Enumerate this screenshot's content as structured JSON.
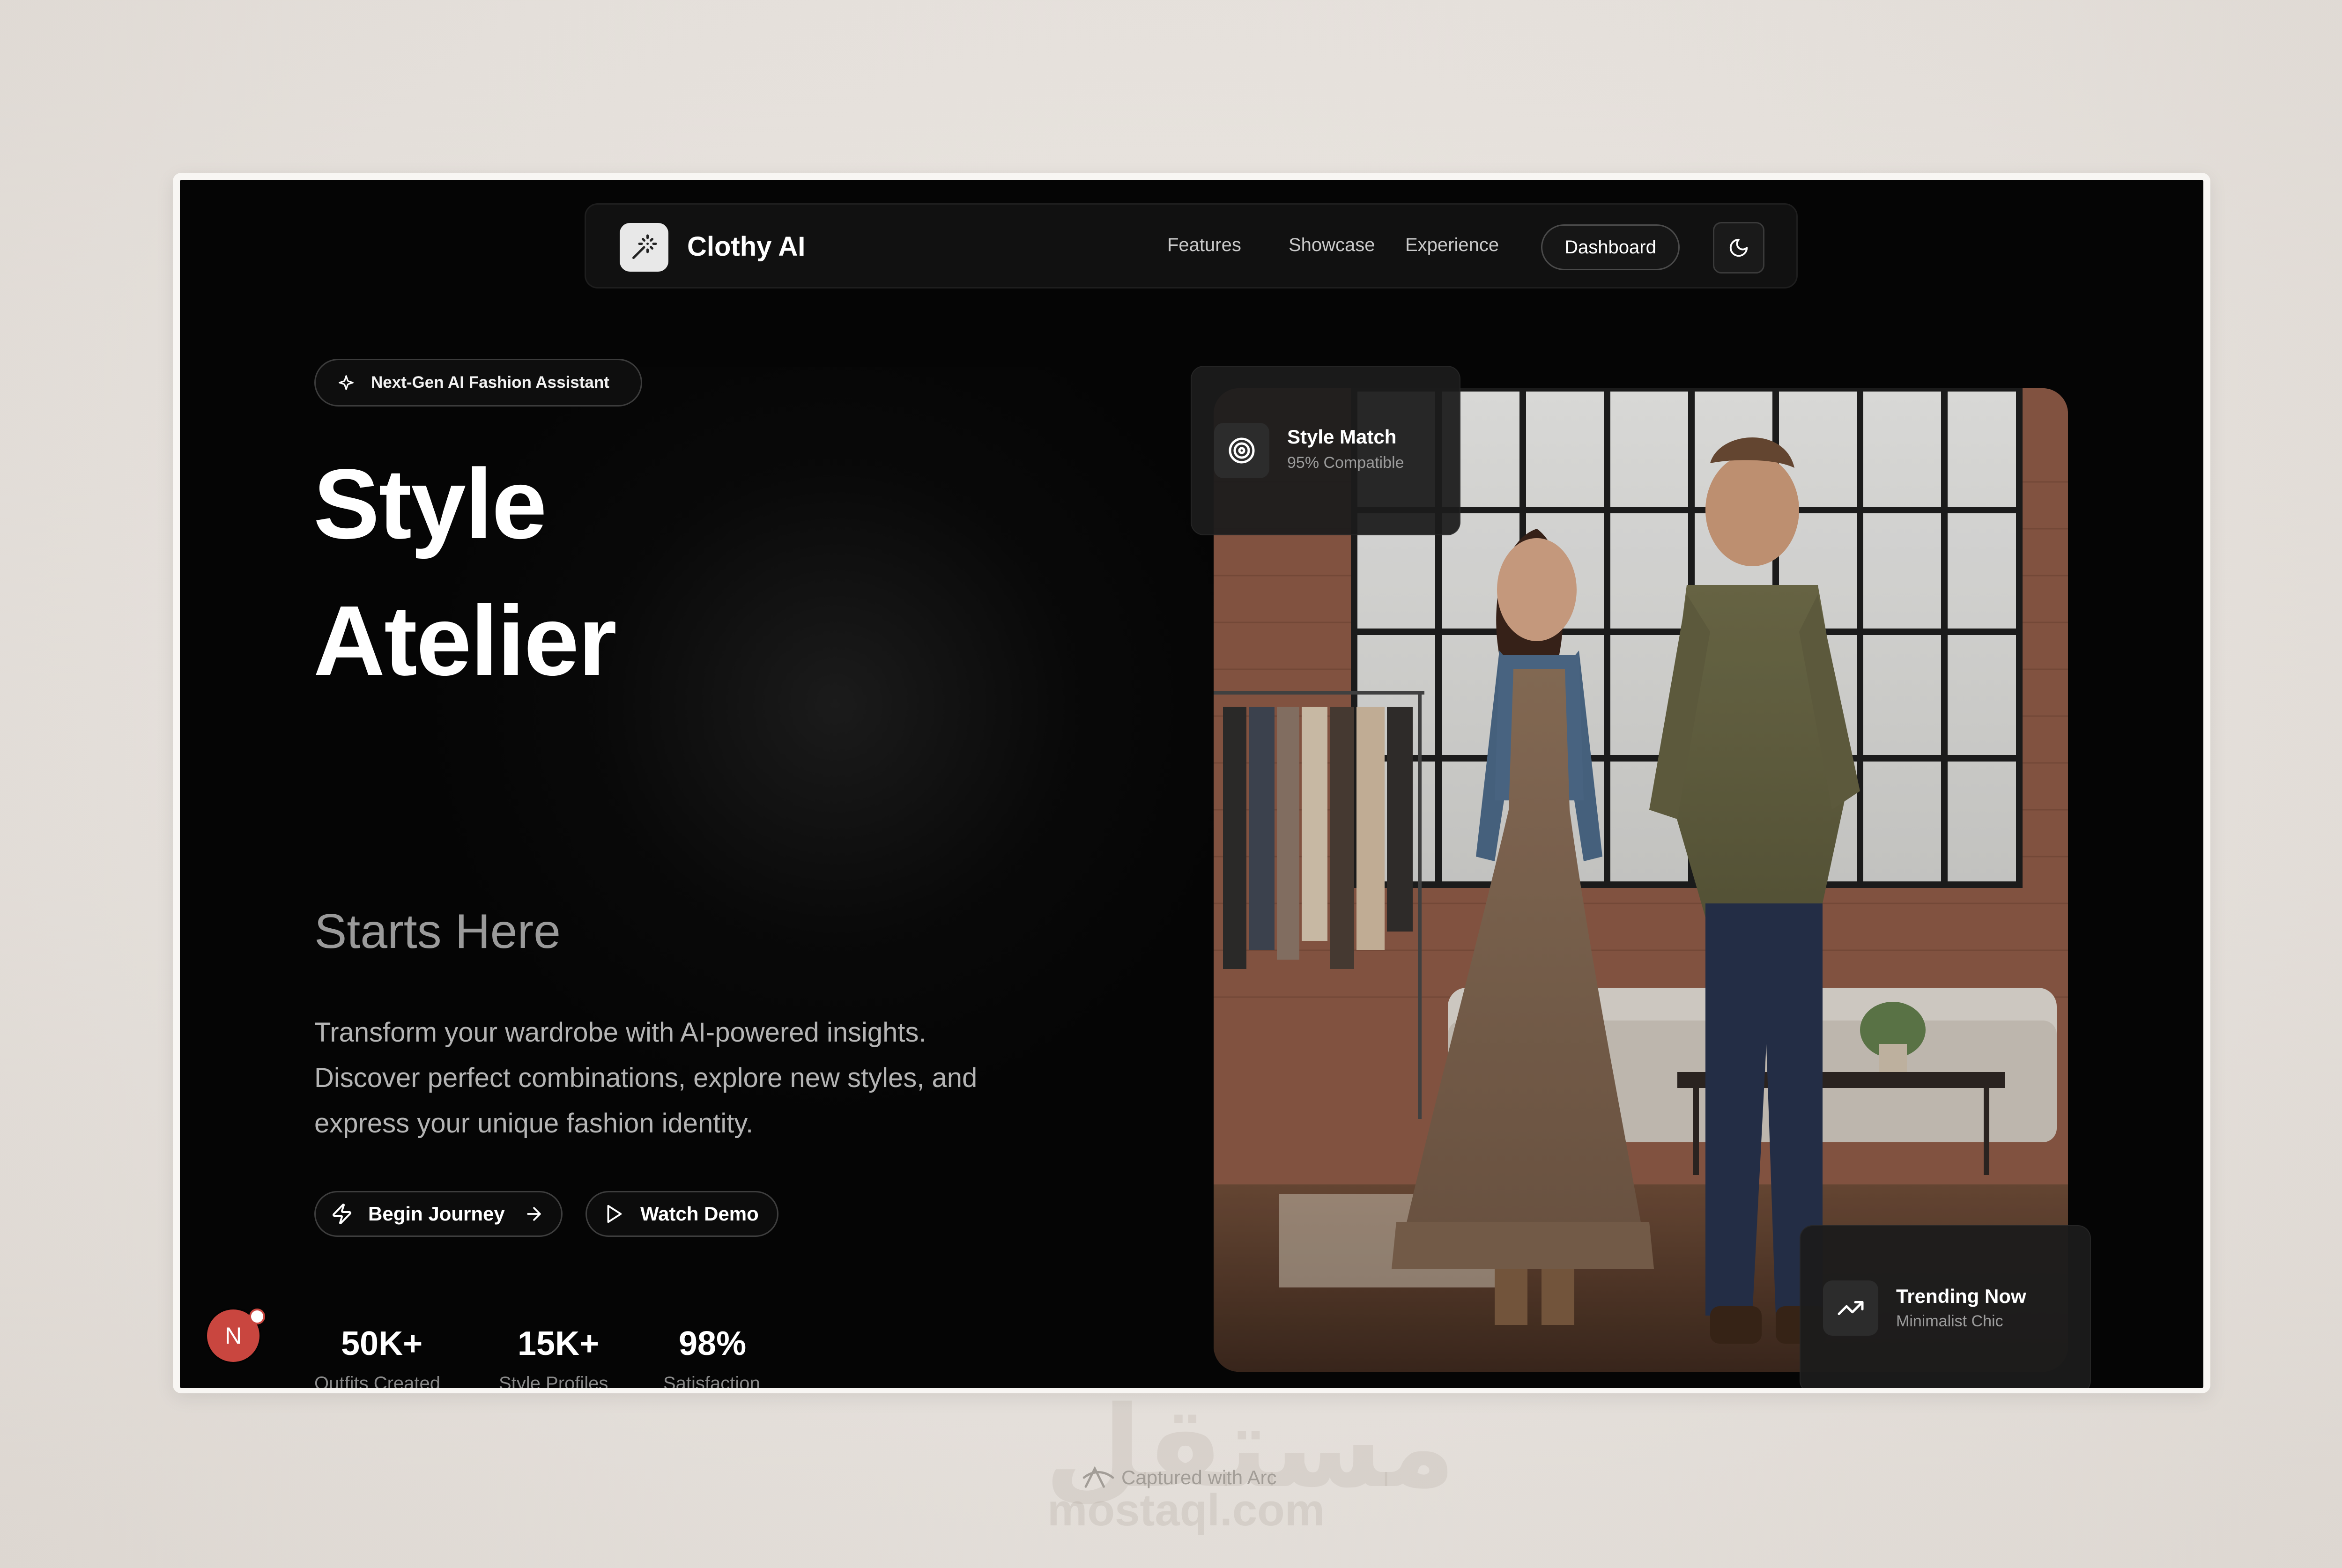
{
  "nav": {
    "brand": "Clothy AI",
    "links": [
      "Features",
      "Showcase",
      "Experience"
    ],
    "dashboard_label": "Dashboard"
  },
  "hero": {
    "badge": "Next-Gen AI Fashion Assistant",
    "title_line1": "Style",
    "title_line2": "Atelier",
    "subtitle": "Starts Here",
    "description": [
      "Transform your wardrobe with AI-powered insights.",
      "Discover perfect combinations, explore new styles, and",
      "express your unique fashion identity."
    ],
    "begin_label": "Begin Journey",
    "demo_label": "Watch Demo"
  },
  "stats": [
    {
      "value": "50K+",
      "label": "Outfits Created"
    },
    {
      "value": "15K+",
      "label": "Style Profiles"
    },
    {
      "value": "98%",
      "label": "Satisfaction"
    }
  ],
  "style_match": {
    "title": "Style Match",
    "subtitle": "95% Compatible"
  },
  "trending": {
    "title": "Trending Now",
    "subtitle": "Minimalist Chic"
  },
  "avatar_initial": "N",
  "watermark": {
    "arabic": "مستقل",
    "captured": "Captured with Arc",
    "site": "mostaql.com"
  },
  "colors": {
    "screen_bg": "#050505",
    "accent_avatar": "#c9463f",
    "page_bg": "#e4dfda"
  }
}
